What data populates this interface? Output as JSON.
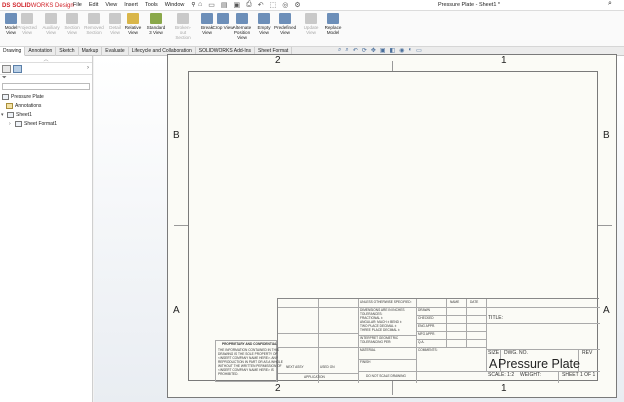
{
  "app": {
    "brand_ds": "DS",
    "brand_sw_prefix": "SOLID",
    "brand_sw_suffix": "WORKS Design",
    "window_title": "Pressure Plate - Sheet1 *",
    "menu": [
      "File",
      "Edit",
      "View",
      "Insert",
      "Tools",
      "Window"
    ],
    "quick_access_icons": [
      "home-icon",
      "new-icon",
      "open-icon",
      "save-icon",
      "print-icon",
      "undo-icon",
      "redo-icon"
    ]
  },
  "ribbon": {
    "buttons": [
      {
        "label": "Model View",
        "enabled": true
      },
      {
        "label": "Projected View",
        "enabled": false
      },
      {
        "label": "Auxiliary View",
        "enabled": false
      },
      {
        "label": "Section View",
        "enabled": false
      },
      {
        "label": "Removed Section",
        "enabled": false
      },
      {
        "label": "Detail View",
        "enabled": false
      },
      {
        "label": "Relative View",
        "enabled": true
      },
      {
        "label": "Standard 3 View",
        "enabled": true
      },
      {
        "label": "Broken-out Section",
        "enabled": false
      },
      {
        "label": "Break View",
        "enabled": true
      },
      {
        "label": "Crop View",
        "enabled": true
      },
      {
        "label": "Alternate Position View",
        "enabled": true
      },
      {
        "label": "Empty View",
        "enabled": true
      },
      {
        "label": "Predefined View",
        "enabled": true
      },
      {
        "label": "Update View",
        "enabled": false
      },
      {
        "label": "Replace Model",
        "enabled": true
      }
    ]
  },
  "tabs": [
    "Drawing",
    "Annotation",
    "Sketch",
    "Markup",
    "Evaluate",
    "Lifecycle and Collaboration",
    "SOLIDWORKS Add-Ins",
    "Sheet Format"
  ],
  "active_tab": "Drawing",
  "tree": {
    "root": "Pressure Plate",
    "annotations": "Annotations",
    "sheet": "Sheet1",
    "sheet_format": "Sheet Format1"
  },
  "sheet": {
    "zones_top": [
      "2",
      "1"
    ],
    "zones_bottom": [
      "2",
      "1"
    ],
    "zones_left": [
      "B",
      "A"
    ],
    "zones_right": [
      "B",
      "A"
    ]
  },
  "title_block": {
    "unless": "UNLESS OTHERWISE SPECIFIED:",
    "dims": "DIMENSIONS ARE IN INCHES",
    "tolerances": "TOLERANCES:",
    "fractional": "FRACTIONAL ±",
    "angular": "ANGULAR: MACH ±   BEND ±",
    "two_place": "TWO PLACE DECIMAL   ±",
    "three_place": "THREE PLACE DECIMAL  ±",
    "interpret": "INTERPRET GEOMETRIC",
    "tolerancing": "TOLERANCING PER:",
    "material": "MATERIAL",
    "finish": "FINISH",
    "name": "NAME",
    "date": "DATE",
    "drawn": "DRAWN",
    "checked": "CHECKED",
    "eng_appr": "ENG APPR.",
    "mfg_appr": "MFG APPR.",
    "qa": "Q.A.",
    "comments": "COMMENTS:",
    "title": "TITLE:",
    "prop_head": "PROPRIETARY AND CONFIDENTIAL",
    "prop_text_1": "THE INFORMATION CONTAINED IN THIS",
    "prop_text_2": "DRAWING IS THE SOLE PROPERTY OF",
    "prop_text_3": "<INSERT COMPANY NAME HERE>. ANY",
    "prop_text_4": "REPRODUCTION IN PART OR AS A WHOLE",
    "prop_text_5": "WITHOUT THE WRITTEN PERMISSION OF",
    "prop_text_6": "<INSERT COMPANY NAME HERE> IS",
    "prop_text_7": "PROHIBITED.",
    "next_assy": "NEXT ASSY",
    "used_on": "USED ON",
    "application": "APPLICATION",
    "do_not_scale": "DO NOT SCALE DRAWING",
    "size": "SIZE",
    "size_value": "A",
    "dwg_no": "DWG. NO.",
    "rev": "REV",
    "part_title": "Pressure Plate",
    "scale": "SCALE: 1:2",
    "weight": "WEIGHT:",
    "sheet_of": "SHEET 1 OF 1"
  }
}
